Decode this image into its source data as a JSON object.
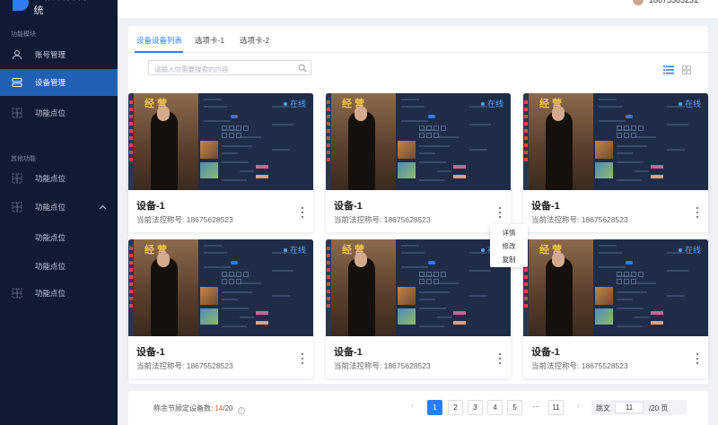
{
  "app": {
    "title": "直播设备管理系统",
    "brand_color": "#2f7cf6",
    "sidebar_bg": "#0f1a33",
    "online_color": "#5aa2ff"
  },
  "user": {
    "phone": "18675585231"
  },
  "sidebar": {
    "group1_label": "功能模块",
    "group2_label": "其他功能",
    "items": [
      {
        "label": "账号管理",
        "icon": "user-icon"
      },
      {
        "label": "设备管理",
        "icon": "device-icon",
        "active": true
      },
      {
        "label": "功能点位",
        "icon": "grid-icon"
      },
      {
        "label": "功能点位",
        "icon": "grid-icon"
      },
      {
        "label": "功能点位",
        "icon": "grid-icon",
        "expanded": true
      },
      {
        "label": "功能点位",
        "icon": "grid-icon"
      }
    ],
    "sub_items": [
      {
        "label": "功能点位"
      },
      {
        "label": "功能点位"
      }
    ]
  },
  "tabs": [
    {
      "label": "设备设备列表",
      "active": true
    },
    {
      "label": "选项卡-1"
    },
    {
      "label": "选项卡-2"
    }
  ],
  "search": {
    "placeholder": "请输入你需要搜索的内容"
  },
  "cards": [
    {
      "name": "设备-1",
      "sub": "当前法控称号: 18675628523",
      "status": "在线",
      "thumb_title": "经营"
    },
    {
      "name": "设备-1",
      "sub": "当前法控称号: 18675628523",
      "status": "在线",
      "thumb_title": "经营"
    },
    {
      "name": "设备-1",
      "sub": "当前法控称号: 18675628523",
      "status": "在线",
      "thumb_title": "经营"
    },
    {
      "name": "设备-1",
      "sub": "当前法控称号: 18675528523",
      "status": "在线",
      "thumb_title": "经营"
    },
    {
      "name": "设备-1",
      "sub": "当前法控称号: 18675628523",
      "status": "在线",
      "thumb_title": "经营"
    },
    {
      "name": "设备-1",
      "sub": "当前法控称号: 18675528523",
      "status": "在线",
      "thumb_title": "经营"
    }
  ],
  "context_menu": {
    "items": [
      "详情",
      "修改",
      "复制"
    ]
  },
  "footer": {
    "summary_label": "称余节顾定设备数:",
    "used": "14",
    "total": "/20",
    "pages": [
      "1",
      "2",
      "3",
      "4",
      "5",
      "···",
      "11"
    ],
    "current_page": "1",
    "jump_label": "跳文",
    "jump_value": "11",
    "jump_total": "/20 页",
    "prev": "‹",
    "next": "›"
  }
}
